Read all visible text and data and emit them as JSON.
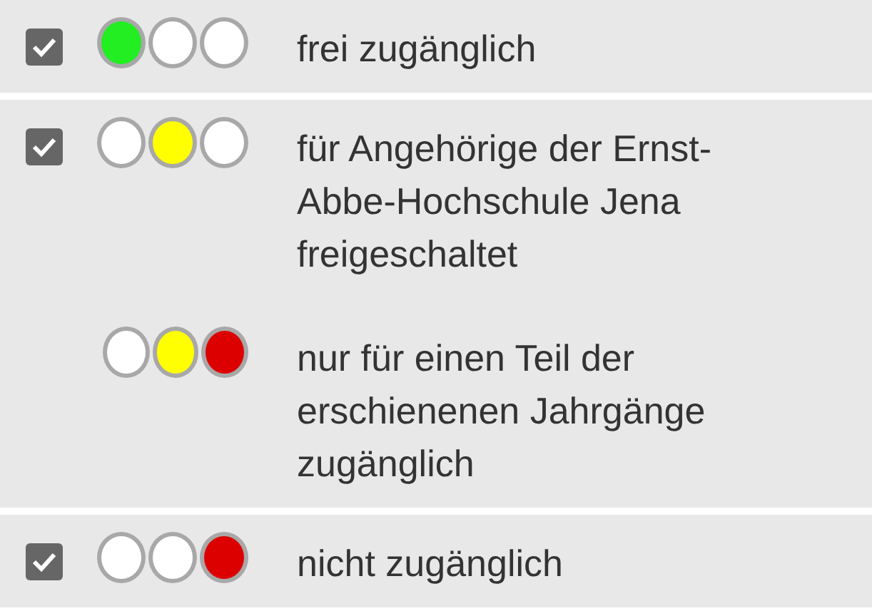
{
  "groups": [
    {
      "checked": true,
      "entries": [
        {
          "lights": [
            {
              "color": "#22ee22"
            },
            {
              "color": "#ffffff"
            },
            {
              "color": "#ffffff"
            }
          ],
          "label": "frei zugänglich"
        }
      ]
    },
    {
      "checked": true,
      "entries": [
        {
          "lights": [
            {
              "color": "#ffffff"
            },
            {
              "color": "#ffff00"
            },
            {
              "color": "#ffffff"
            }
          ],
          "label": "für Angehörige der Ernst-Abbe-Hochschule Jena freigeschaltet"
        },
        {
          "lights": [
            {
              "color": "#ffffff"
            },
            {
              "color": "#ffff00"
            },
            {
              "color": "#dd0000"
            }
          ],
          "label": "nur für einen Teil der erschienenen Jahrgänge zugänglich"
        }
      ]
    },
    {
      "checked": true,
      "entries": [
        {
          "lights": [
            {
              "color": "#ffffff"
            },
            {
              "color": "#ffffff"
            },
            {
              "color": "#dd0000"
            }
          ],
          "label": "nicht zugänglich"
        }
      ]
    }
  ]
}
